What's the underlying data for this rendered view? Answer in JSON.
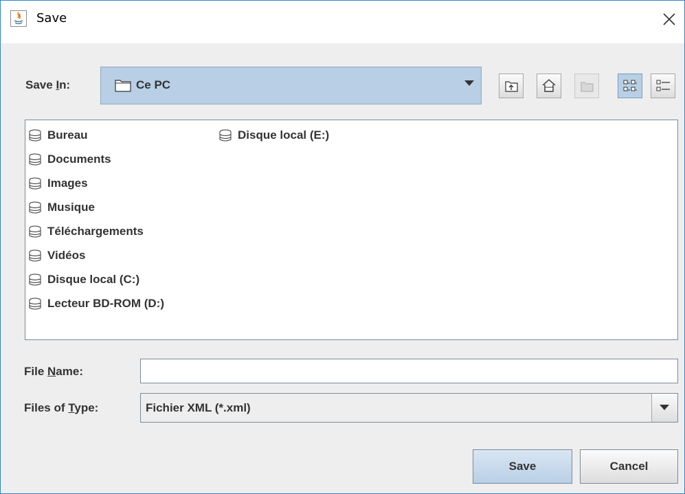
{
  "window": {
    "title": "Save",
    "close_glyph": "✕"
  },
  "save_in": {
    "label_prefix": "Save ",
    "label_mnemonic": "I",
    "label_suffix": "n:",
    "value": "Ce PC",
    "icon": "folder-icon"
  },
  "toolbar": {
    "buttons": [
      {
        "name": "up-one-level",
        "icon": "up-folder-icon",
        "enabled": true
      },
      {
        "name": "home",
        "icon": "home-icon",
        "enabled": true
      },
      {
        "name": "new-folder",
        "icon": "new-folder-icon",
        "enabled": false
      },
      {
        "name": "list-view",
        "icon": "list-view-icon",
        "enabled": true,
        "selected": true
      },
      {
        "name": "details-view",
        "icon": "details-view-icon",
        "enabled": true,
        "selected": false
      }
    ]
  },
  "file_list": {
    "items": [
      {
        "label": "Bureau",
        "icon": "drive-icon"
      },
      {
        "label": "Documents",
        "icon": "drive-icon"
      },
      {
        "label": "Images",
        "icon": "drive-icon"
      },
      {
        "label": "Musique",
        "icon": "drive-icon"
      },
      {
        "label": "Téléchargements",
        "icon": "drive-icon"
      },
      {
        "label": "Vidéos",
        "icon": "drive-icon"
      },
      {
        "label": "Disque local (C:)",
        "icon": "drive-icon"
      },
      {
        "label": "Lecteur BD-ROM (D:)",
        "icon": "drive-icon"
      },
      {
        "label": "Disque local (E:)",
        "icon": "drive-icon"
      }
    ]
  },
  "file_name": {
    "label_prefix": "File ",
    "label_mnemonic": "N",
    "label_suffix": "ame:",
    "value": "",
    "placeholder": ""
  },
  "files_of_type": {
    "label_prefix": "Files of ",
    "label_mnemonic": "T",
    "label_suffix": "ype:",
    "value": "Fichier XML (*.xml)"
  },
  "buttons": {
    "save_label": "Save",
    "cancel_label": "Cancel"
  },
  "colors": {
    "title_border": "#2f84c9",
    "selection_blue": "#b8cfe5",
    "panel_bg": "#eeeeee",
    "text": "#333333"
  }
}
